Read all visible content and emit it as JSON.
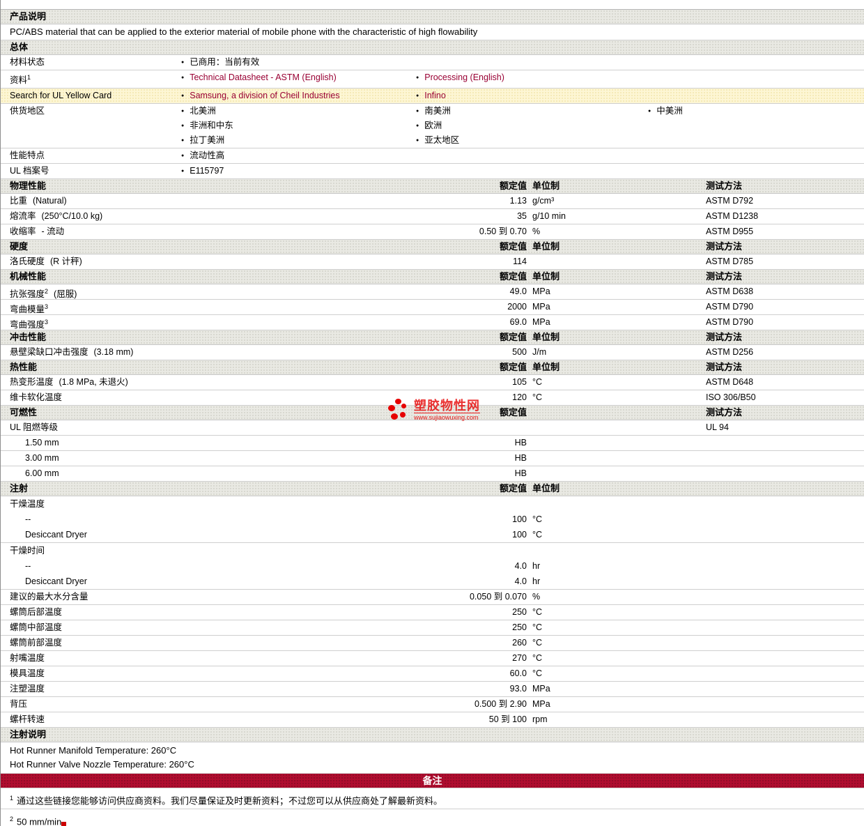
{
  "colors": {
    "link": "#990033",
    "remark": "#B00D2F",
    "logo": "#E60000",
    "header_bg": "#E9E9E3",
    "highlight": "#FDF6D4"
  },
  "logo": {
    "text": "塑胶物性网",
    "url": "www.sujiaowuxing.com"
  },
  "sections": [
    {
      "type": "header",
      "id": "product-description",
      "title": "产品说明"
    },
    {
      "type": "text",
      "title": "PC/ABS material that can be applied to the exterior material of mobile phone with the characteristic of high flowability"
    },
    {
      "type": "header",
      "id": "general",
      "title": "总体"
    },
    {
      "type": "info",
      "label": "材料状态",
      "cols": [
        [
          "已商用：当前有效"
        ]
      ]
    },
    {
      "type": "info",
      "label": "资料",
      "sup": "1",
      "cols": [
        [
          {
            "text": "Technical Datasheet - ASTM (English)",
            "link": "technical-datasheet-link"
          }
        ],
        [
          {
            "text": "Processing (English)",
            "link": "processing-link"
          }
        ]
      ]
    },
    {
      "type": "info",
      "label": "Search for UL Yellow Card",
      "highlight": true,
      "cols": [
        [
          {
            "text": "Samsung, a division of Cheil Industries",
            "link": "samsung-link"
          }
        ],
        [
          {
            "text": "Infino",
            "link": "infino-link"
          }
        ]
      ]
    },
    {
      "type": "info",
      "label": "供货地区",
      "cols": [
        [
          "北美洲",
          "非洲和中东",
          "拉丁美洲"
        ],
        [
          "南美洲",
          "欧洲",
          "亚太地区"
        ],
        [
          "中美洲"
        ]
      ]
    },
    {
      "type": "info",
      "label": "性能特点",
      "cols": [
        [
          "流动性高"
        ]
      ]
    },
    {
      "type": "info",
      "label": "UL 档案号",
      "cols": [
        [
          "E115797"
        ]
      ]
    },
    {
      "type": "cols-header",
      "title": "物理性能",
      "rated": "额定值",
      "unit": "单位制",
      "method": "测试方法"
    },
    {
      "type": "prop",
      "label": "比重",
      "note": "(Natural)",
      "value": "1.13",
      "unit": "g/cm³",
      "method": "ASTM D792"
    },
    {
      "type": "prop",
      "label": "熔流率",
      "note": "(250°C/10.0 kg)",
      "value": "35",
      "unit": "g/10 min",
      "method": "ASTM D1238"
    },
    {
      "type": "prop",
      "label": "收缩率",
      "note": "- 流动",
      "value": "0.50 到 0.70",
      "unit": "%",
      "method": "ASTM D955"
    },
    {
      "type": "cols-header",
      "title": "硬度",
      "rated": "额定值",
      "unit": "单位制",
      "method": "测试方法"
    },
    {
      "type": "prop",
      "label": "洛氏硬度",
      "note": "(R 计秤)",
      "value": "114",
      "unit": "",
      "method": "ASTM D785"
    },
    {
      "type": "cols-header",
      "title": "机械性能",
      "rated": "额定值",
      "unit": "单位制",
      "method": "测试方法"
    },
    {
      "type": "prop",
      "label": "抗张强度",
      "sup": "2",
      "note": "(屈服)",
      "value": "49.0",
      "unit": "MPa",
      "method": "ASTM D638"
    },
    {
      "type": "prop",
      "label": "弯曲模量",
      "sup": "3",
      "value": "2000",
      "unit": "MPa",
      "method": "ASTM D790"
    },
    {
      "type": "prop",
      "label": "弯曲强度",
      "sup": "3",
      "value": "69.0",
      "unit": "MPa",
      "method": "ASTM D790"
    },
    {
      "type": "cols-header",
      "title": "冲击性能",
      "rated": "额定值",
      "unit": "单位制",
      "method": "测试方法"
    },
    {
      "type": "prop",
      "label": "悬壁梁缺口冲击强度",
      "note": "(3.18 mm)",
      "value": "500",
      "unit": "J/m",
      "method": "ASTM D256"
    },
    {
      "type": "cols-header",
      "title": "热性能",
      "rated": "额定值",
      "unit": "单位制",
      "method": "测试方法"
    },
    {
      "type": "prop",
      "label": "热变形温度",
      "note": "(1.8 MPa, 未退火)",
      "value": "105",
      "unit": "°C",
      "method": "ASTM D648"
    },
    {
      "type": "prop",
      "label": "维卡软化温度",
      "value": "120",
      "unit": "°C",
      "method": "ISO 306/B50"
    },
    {
      "type": "cols-header",
      "title": "可燃性",
      "rated": "额定值",
      "unit": "",
      "method": "测试方法"
    },
    {
      "type": "prop",
      "label": "UL 阻燃等级",
      "value": "",
      "unit": "",
      "method": "UL 94"
    },
    {
      "type": "prop",
      "label": "1.50 mm",
      "indent": true,
      "value": "HB",
      "unit": "",
      "method": ""
    },
    {
      "type": "prop",
      "label": "3.00 mm",
      "indent": true,
      "value": "HB",
      "unit": "",
      "method": ""
    },
    {
      "type": "prop",
      "label": "6.00 mm",
      "indent": true,
      "value": "HB",
      "unit": "",
      "method": ""
    },
    {
      "type": "cols-header",
      "title": "注射",
      "rated": "额定值",
      "unit": "单位制",
      "method": ""
    },
    {
      "type": "group",
      "label": "干燥温度",
      "lines": [
        {
          "label": "--",
          "value": "100",
          "unit": "°C"
        },
        {
          "label": "Desiccant Dryer",
          "value": "100",
          "unit": "°C"
        }
      ]
    },
    {
      "type": "group",
      "label": "干燥时间",
      "lines": [
        {
          "label": "--",
          "value": "4.0",
          "unit": "hr"
        },
        {
          "label": "Desiccant Dryer",
          "value": "4.0",
          "unit": "hr"
        }
      ]
    },
    {
      "type": "prop",
      "label": "建议的最大水分含量",
      "value": "0.050 到 0.070",
      "unit": "%",
      "method": ""
    },
    {
      "type": "prop",
      "label": "螺筒后部温度",
      "value": "250",
      "unit": "°C",
      "method": ""
    },
    {
      "type": "prop",
      "label": "螺筒中部温度",
      "value": "250",
      "unit": "°C",
      "method": ""
    },
    {
      "type": "prop",
      "label": "螺筒前部温度",
      "value": "260",
      "unit": "°C",
      "method": ""
    },
    {
      "type": "prop",
      "label": "射嘴温度",
      "value": "270",
      "unit": "°C",
      "method": ""
    },
    {
      "type": "prop",
      "label": "模具温度",
      "value": "60.0",
      "unit": "°C",
      "method": ""
    },
    {
      "type": "prop",
      "label": "注塑温度",
      "value": "93.0",
      "unit": "MPa",
      "method": ""
    },
    {
      "type": "prop",
      "label": "背压",
      "value": "0.500 到 2.90",
      "unit": "MPa",
      "method": ""
    },
    {
      "type": "prop",
      "label": "螺杆转速",
      "value": "50 到 100",
      "unit": "rpm",
      "method": ""
    },
    {
      "type": "header",
      "id": "injection-notes",
      "title": "注射说明"
    },
    {
      "type": "lines",
      "lines": [
        "Hot Runner Manifold Temperature: 260°C",
        "Hot Runner Valve Nozzle Temperature: 260°C"
      ]
    },
    {
      "type": "remark",
      "title": "备注"
    },
    {
      "type": "footnote",
      "sup": "1",
      "text": "通过这些链接您能够访问供应商资料。我们尽量保证及时更新资料；不过您可以从供应商处了解最新资料。"
    },
    {
      "type": "footnote",
      "sup": "2",
      "text": "50 mm/min"
    }
  ]
}
